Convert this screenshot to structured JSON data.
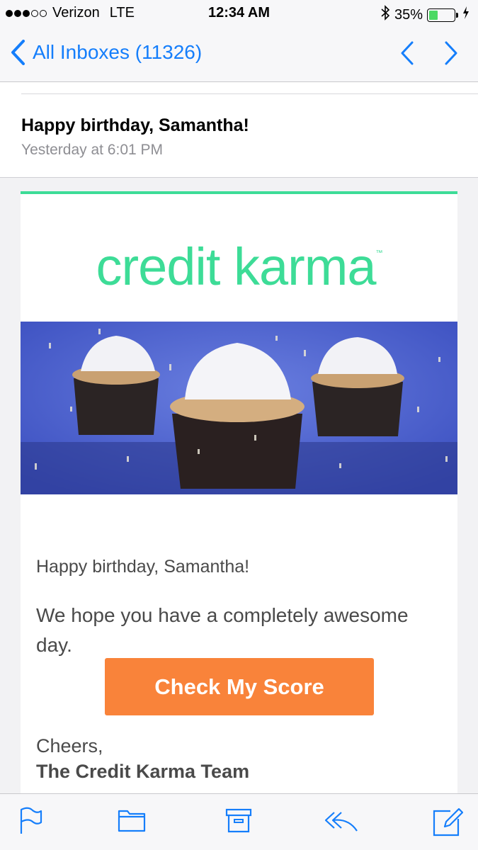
{
  "status_bar": {
    "carrier": "Verizon",
    "network": "LTE",
    "time": "12:34 AM",
    "battery_percent": "35%",
    "battery_level": 0.35,
    "icons": [
      "signal-dots",
      "bluetooth-icon",
      "battery-icon",
      "charging-bolt-icon"
    ]
  },
  "nav": {
    "back_label": "All Inboxes (11326)",
    "icons": [
      "chevron-left-icon",
      "chevron-up-icon",
      "chevron-down-icon"
    ]
  },
  "message": {
    "subject": "Happy birthday, Samantha!",
    "date": "Yesterday at 6:01 PM"
  },
  "email": {
    "logo_text": "credit karma",
    "logo_tm": "™",
    "greeting": "Happy birthday, Samantha!",
    "body": "We hope you have a completely awesome day.",
    "cta_label": "Check My Score",
    "signoff": "Cheers,",
    "signature": "The Credit Karma Team",
    "colors": {
      "brand_green": "#3ddc97",
      "cta_orange": "#f9833a"
    }
  },
  "toolbar": {
    "icons": [
      "flag-icon",
      "folder-icon",
      "archive-icon",
      "reply-icon",
      "compose-icon"
    ]
  },
  "colors": {
    "ios_blue": "#157efb"
  }
}
